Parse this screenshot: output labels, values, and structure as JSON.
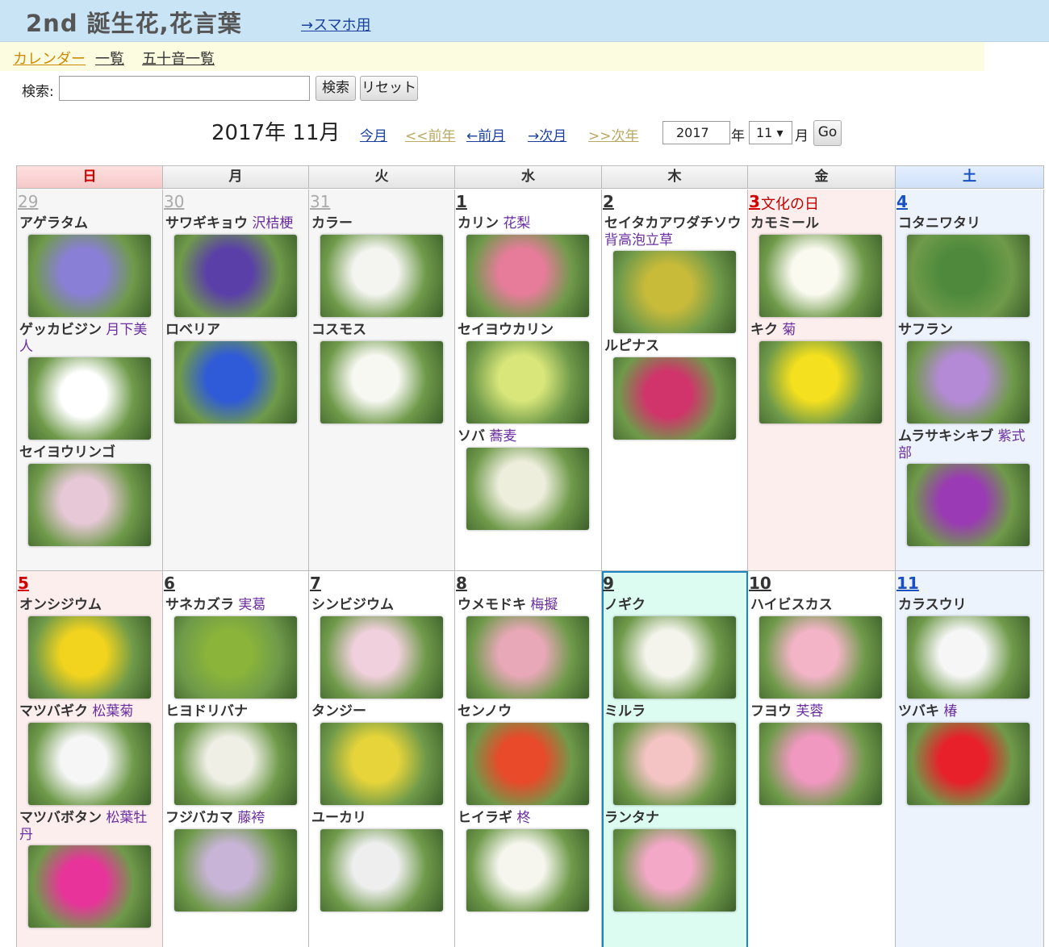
{
  "site": {
    "title": "2nd 誕生花,花言葉",
    "smartphone_link": "→スマホ用"
  },
  "menu": {
    "calendar": "カレンダー",
    "list": "一覧",
    "gojuon": "五十音一覧"
  },
  "search": {
    "label": "検索:",
    "value": "",
    "search_button": "検索",
    "reset_button": "リセット"
  },
  "nav": {
    "month_title": "2017年 11月",
    "this_month": "今月",
    "prev_year": "<<前年",
    "prev_month": "←前月",
    "next_month": "→次月",
    "next_year": ">>次年",
    "year_value": "2017",
    "year_unit": "年",
    "month_value": "11 ▾",
    "month_unit": "月",
    "go_button": "Go"
  },
  "weekdays": [
    "日",
    "月",
    "火",
    "水",
    "木",
    "金",
    "土"
  ],
  "colors": {
    "header": "#c9e4f5",
    "menu": "#fcfce0",
    "sunday": "#fdeeee",
    "saturday": "#edf3fd",
    "today": "#dcfbf1"
  },
  "weeks": [
    [
      {
        "day": "29",
        "flowers": [
          {
            "name": "アゲラタム",
            "kanji": "",
            "color": "#8a7fd6"
          },
          {
            "name": "ゲッカビジン",
            "kanji": "月下美人",
            "color": "#ffffff"
          },
          {
            "name": "セイヨウリンゴ",
            "kanji": "",
            "color": "#e6c8d6"
          }
        ]
      },
      {
        "day": "30",
        "flowers": [
          {
            "name": "サワギキョウ",
            "kanji": "沢桔梗",
            "color": "#5a3fa8"
          },
          {
            "name": "ロベリア",
            "kanji": "",
            "color": "#2f5ad8"
          }
        ]
      },
      {
        "day": "31",
        "flowers": [
          {
            "name": "カラー",
            "kanji": "",
            "color": "#f4f4f0"
          },
          {
            "name": "コスモス",
            "kanji": "",
            "color": "#f8f8f2"
          }
        ]
      },
      {
        "day": "1",
        "flowers": [
          {
            "name": "カリン",
            "kanji": "花梨",
            "color": "#e67c9a"
          },
          {
            "name": "セイヨウカリン",
            "kanji": "",
            "color": "#d8e67a"
          },
          {
            "name": "ソバ",
            "kanji": "蕎麦",
            "color": "#eeeedd"
          }
        ]
      },
      {
        "day": "2",
        "flowers": [
          {
            "name": "セイタカアワダチソウ",
            "kanji": "背高泡立草",
            "color": "#c9bb3a"
          },
          {
            "name": "ルピナス",
            "kanji": "",
            "color": "#d0346a"
          }
        ]
      },
      {
        "day": "3",
        "holiday": "文化の日",
        "flowers": [
          {
            "name": "カモミール",
            "kanji": "",
            "color": "#fafaf0"
          },
          {
            "name": "キク",
            "kanji": "菊",
            "color": "#f4e01e"
          }
        ]
      },
      {
        "day": "4",
        "flowers": [
          {
            "name": "コタニワタリ",
            "kanji": "",
            "color": "#4f8a3c"
          },
          {
            "name": "サフラン",
            "kanji": "",
            "color": "#b48ad6"
          },
          {
            "name": "ムラサキシキブ",
            "kanji": "紫式部",
            "color": "#9a3ab4"
          }
        ]
      }
    ],
    [
      {
        "day": "5",
        "flowers": [
          {
            "name": "オンシジウム",
            "kanji": "",
            "color": "#f2d41e"
          },
          {
            "name": "マツバギク",
            "kanji": "松葉菊",
            "color": "#f6f6f6"
          },
          {
            "name": "マツバボタン",
            "kanji": "松葉牡丹",
            "color": "#e8349a"
          }
        ]
      },
      {
        "day": "6",
        "flowers": [
          {
            "name": "サネカズラ",
            "kanji": "実葛",
            "color": "#8ab43a"
          },
          {
            "name": "ヒヨドリバナ",
            "kanji": "",
            "color": "#efefe6"
          },
          {
            "name": "フジバカマ",
            "kanji": "藤袴",
            "color": "#c8b4d6"
          }
        ]
      },
      {
        "day": "7",
        "flowers": [
          {
            "name": "シンビジウム",
            "kanji": "",
            "color": "#f0d0dc"
          },
          {
            "name": "タンジー",
            "kanji": "",
            "color": "#e6d43a"
          },
          {
            "name": "ユーカリ",
            "kanji": "",
            "color": "#eeeeee"
          }
        ]
      },
      {
        "day": "8",
        "flowers": [
          {
            "name": "ウメモドキ",
            "kanji": "梅擬",
            "color": "#e8a8b8"
          },
          {
            "name": "センノウ",
            "kanji": "",
            "color": "#e84a2a"
          },
          {
            "name": "ヒイラギ",
            "kanji": "柊",
            "color": "#f6f6ee"
          }
        ]
      },
      {
        "day": "9",
        "today": true,
        "flowers": [
          {
            "name": "ノギク",
            "kanji": "",
            "color": "#f4f4ec"
          },
          {
            "name": "ミルラ",
            "kanji": "",
            "color": "#f4c4c4"
          },
          {
            "name": "ランタナ",
            "kanji": "",
            "color": "#f4a8c8"
          }
        ]
      },
      {
        "day": "10",
        "flowers": [
          {
            "name": "ハイビスカス",
            "kanji": "",
            "color": "#f4b4c8"
          },
          {
            "name": "フヨウ",
            "kanji": "芙蓉",
            "color": "#f098c0"
          }
        ]
      },
      {
        "day": "11",
        "flowers": [
          {
            "name": "カラスウリ",
            "kanji": "",
            "color": "#f6f6f6"
          },
          {
            "name": "ツバキ",
            "kanji": "椿",
            "color": "#e8202a"
          }
        ]
      }
    ]
  ]
}
